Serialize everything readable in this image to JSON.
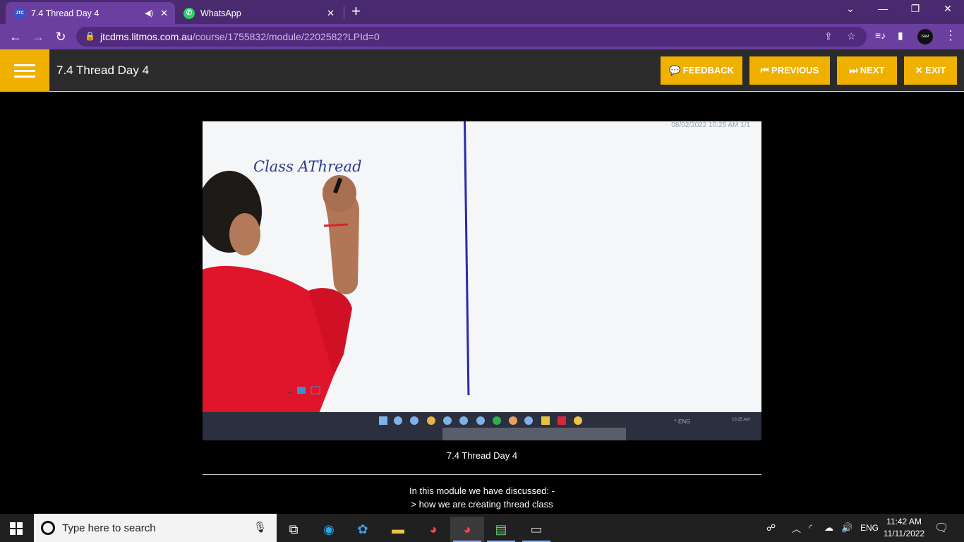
{
  "browser": {
    "tabs": [
      {
        "favicon": "JTC",
        "title": "7.4 Thread Day 4",
        "active": true,
        "audio": true
      },
      {
        "favicon": "whatsapp-icon",
        "title": "WhatsApp",
        "active": false
      }
    ],
    "url_host": "jtcdms.litmos.com.au",
    "url_path": "/course/1755832/module/2202582?LPId=0",
    "profile_label": "SAM"
  },
  "course": {
    "title": "7.4 Thread Day 4",
    "buttons": {
      "feedback": "💬 FEEDBACK",
      "previous": "⏮ PREVIOUS",
      "next": "⏭ NEXT",
      "exit": "✕ EXIT"
    }
  },
  "video": {
    "whiteboard_date": "08/02/2022  10:25 AM  1/1",
    "whiteboard_text": "Class AThread"
  },
  "module": {
    "video_title": "7.4 Thread Day 4",
    "description_line1": "In this module we have discussed: -",
    "description_line2": "> how we are creating thread class"
  },
  "taskbar": {
    "search_placeholder": "Type here to search",
    "language": "ENG",
    "time": "11:42 AM",
    "date": "11/11/2022"
  },
  "colors": {
    "accent": "#f0b000",
    "browser_frame": "#4a2a6e",
    "browser_toolbar": "#6b3fa0",
    "header_bg": "#2b2b2b"
  }
}
